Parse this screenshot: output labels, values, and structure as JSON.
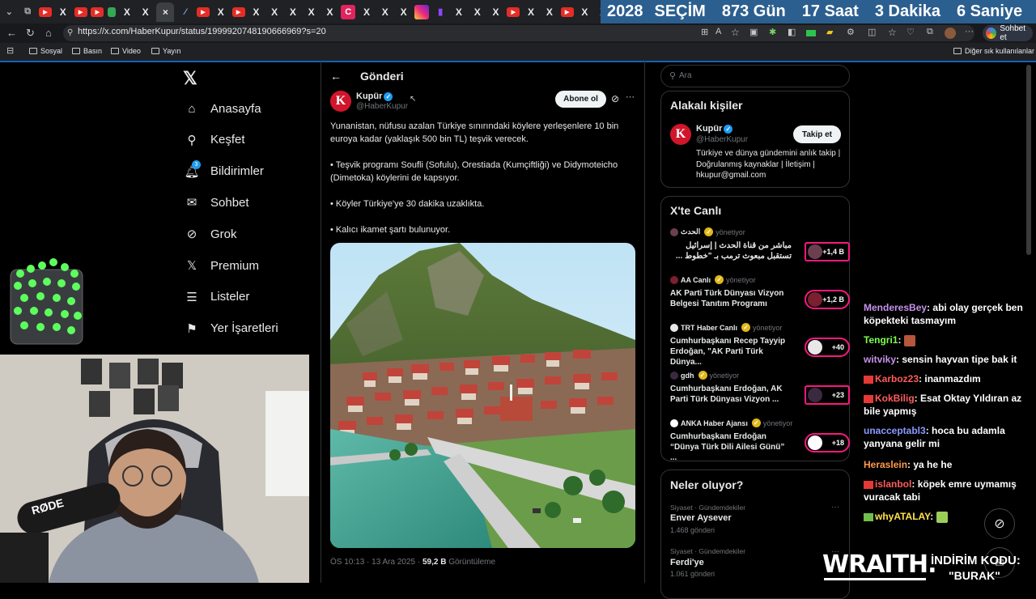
{
  "browser": {
    "tab_icons": [
      "yt",
      "x",
      "yt",
      "yt",
      "g",
      "x",
      "x",
      "close",
      "f",
      "yt",
      "x",
      "yt",
      "x",
      "x",
      "x",
      "x",
      "x",
      "c",
      "x",
      "x",
      "x",
      "ig",
      "t",
      "x",
      "x",
      "x",
      "yt",
      "x",
      "x",
      "yt",
      "x",
      "x",
      "x",
      "x",
      "x"
    ],
    "counter": {
      "year": "2028",
      "label": "SEÇİM",
      "days": "873 Gün",
      "hours": "17 Saat",
      "minutes": "3 Dakika",
      "seconds": "6 Saniye"
    },
    "url": "https://x.com/HaberKupur/status/1999920748190666969?s=20",
    "copilot_label": "Sohbet et",
    "bookmarks": [
      "Sosyal",
      "Basın",
      "Video",
      "Yayın"
    ],
    "other_bookmarks": "Diğer sık kullanılanlar"
  },
  "nav": [
    {
      "label": "Anasayfa",
      "icon": "home-icon"
    },
    {
      "label": "Keşfet",
      "icon": "search-icon"
    },
    {
      "label": "Bildirimler",
      "icon": "bell-icon",
      "badge": "3"
    },
    {
      "label": "Sohbet",
      "icon": "mail-icon"
    },
    {
      "label": "Grok",
      "icon": "grok-icon"
    },
    {
      "label": "Premium",
      "icon": "x-logo-icon"
    },
    {
      "label": "Listeler",
      "icon": "list-icon"
    },
    {
      "label": "Yer İşaretleri",
      "icon": "bookmark-icon"
    }
  ],
  "post": {
    "header": "Gönderi",
    "name": "Kupür",
    "handle": "@HaberKupur",
    "subscribe": "Abone ol",
    "paragraphs": [
      "Yunanistan, nüfusu azalan Türkiye sınırındaki köylere yerleşenlere 10 bin euroya kadar (yaklaşık 500 bin TL) teşvik verecek.",
      "• Teşvik programı Soufli (Sofulu), Orestiada (Kumçiftliği) ve Didymoteicho (Dimetoka) köylerini de kapsıyor.",
      "• Köyler Türkiye'ye 30 dakika uzaklıkta.",
      "• Kalıcı ikamet şartı bulunuyor."
    ],
    "time": "ÖS 10:13 · 13 Ara 2025 · ",
    "views_count": "59,2 B",
    "views_label": " Görüntüleme"
  },
  "search": {
    "placeholder": "Ara"
  },
  "related": {
    "title": "Alakalı kişiler",
    "name": "Kupür",
    "handle": "@HaberKupur",
    "follow": "Takip et",
    "bio": "Türkiye ve dünya gündemini anlık takip | Doğrulanmış kaynaklar | İletişim | hkupur@gmail.com"
  },
  "live": {
    "title": "X'te Canlı",
    "status": "yönetiyor",
    "items": [
      {
        "name": "الحدث",
        "title": "مباشر من قناة الحدث | إسرائيل تستقبل مبعوث ترمب بـ \"خطوط ...",
        "count": "+1,4 B",
        "rtl": true
      },
      {
        "name": "AA Canlı",
        "title": "AK Parti Türk Dünyası Vizyon Belgesi Tanıtım Programı",
        "count": "+1,2 B"
      },
      {
        "name": "TRT Haber Canlı",
        "title": "Cumhurbaşkanı Recep Tayyip Erdoğan, \"AK Parti Türk Dünya...",
        "count": "+40"
      },
      {
        "name": "gdh",
        "title": "Cumhurbaşkanı Erdoğan, AK Parti Türk Dünyası Vizyon ...",
        "count": "+23"
      },
      {
        "name": "ANKA Haber Ajansı",
        "title": "Cumhurbaşkanı Erdoğan “Dünya Türk Dili Ailesi Günü” ...",
        "count": "+18"
      }
    ]
  },
  "trends": {
    "title": "Neler oluyor?",
    "items": [
      {
        "meta": "Siyaset · Gündemdekiler",
        "name": "Enver Aysever",
        "posts": "1.468 gönderi"
      },
      {
        "meta": "Siyaset · Gündemdekiler",
        "name": "Ferdi'ye",
        "posts": "1.061 gönderi"
      }
    ]
  },
  "chat": [
    {
      "user": "MenderesBey",
      "color": "#c792ea",
      "msg": "abi olay gerçek ben köpekteki tasmayım"
    },
    {
      "user": "Tengri1",
      "color": "#7cff4f",
      "msg": ""
    },
    {
      "user": "witviky",
      "color": "#c792ea",
      "msg": "sensin hayvan tipe bak it"
    },
    {
      "user": "Karboz23",
      "color": "#ff5c5c",
      "msg": "inanmazdım"
    },
    {
      "user": "KokBilig",
      "color": "#ff5c5c",
      "msg": "Esat Oktay Yıldıran az bile yapmış"
    },
    {
      "user": "unacceptabl3",
      "color": "#8a9bff",
      "msg": "hoca bu adamla yanyana gelir mi"
    },
    {
      "user": "Heraslein",
      "color": "#ff9a4d",
      "msg": "ya he he"
    },
    {
      "user": "islanbol",
      "color": "#ff5c5c",
      "msg": "köpek emre uymamış vuracak tabi"
    },
    {
      "user": "whyATALAY",
      "color": "#ffe24d",
      "msg": ""
    }
  ],
  "overlay": {
    "brand": "WRAITH.",
    "promo": "İNDİRİM KODU:",
    "code": "\"BURAK\""
  }
}
